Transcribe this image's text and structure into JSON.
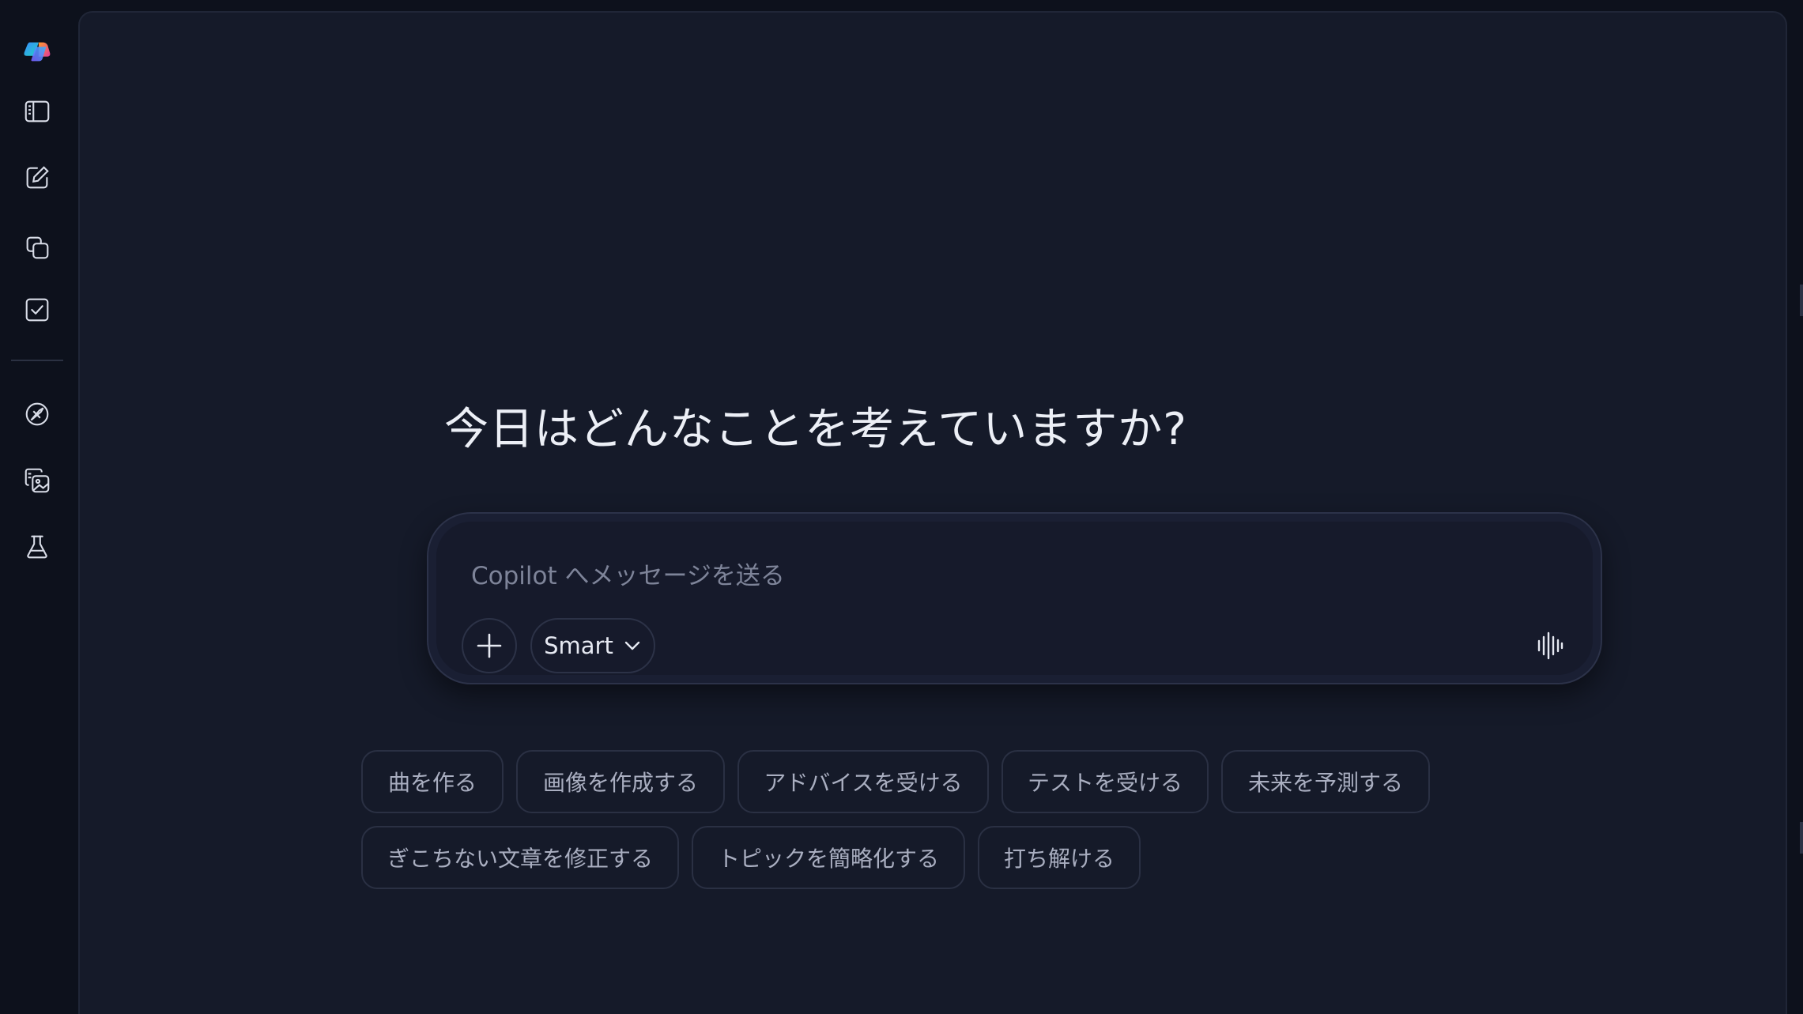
{
  "rail": {
    "items": [
      {
        "name": "copilot-logo",
        "icon": "copilot-logo-icon"
      },
      {
        "name": "toggle-sidebar",
        "icon": "sidebar-icon"
      },
      {
        "name": "new-chat",
        "icon": "compose-icon"
      },
      {
        "name": "pages",
        "icon": "copy-pages-icon"
      },
      {
        "name": "tasks",
        "icon": "checkbox-icon"
      },
      {
        "name": "discover",
        "icon": "compass-icon"
      },
      {
        "name": "image-gallery",
        "icon": "image-gallery-icon"
      },
      {
        "name": "labs",
        "icon": "flask-icon"
      }
    ]
  },
  "main": {
    "heading": "今日はどんなことを考えていますか?"
  },
  "composer": {
    "placeholder": "Copilot へメッセージを送る",
    "mode_label": "Smart",
    "plus_icon": "plus-icon",
    "mode_icon": "chevron-down-icon",
    "voice_icon": "voice-waveform-icon"
  },
  "suggestions": {
    "row1": [
      "曲を作る",
      "画像を作成する",
      "アドバイスを受ける",
      "テストを受ける",
      "未来を予測する"
    ],
    "row2": [
      "ぎこちない文章を修正する",
      "トピックを簡略化する",
      "打ち解ける"
    ]
  },
  "colors": {
    "background": "#0d111c",
    "panel": "#151a29",
    "text_primary": "#eceff6",
    "text_muted": "#a9aec0",
    "border": "#2a3043"
  }
}
